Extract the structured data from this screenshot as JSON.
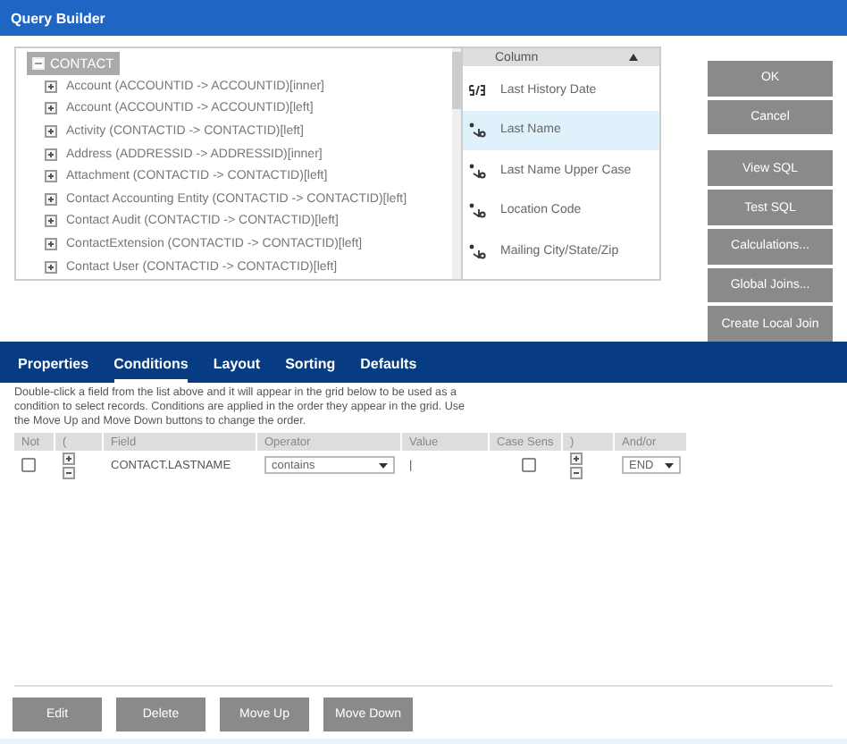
{
  "window": {
    "title": "Query Builder"
  },
  "tree": {
    "label": "CONTACT",
    "expanded": true,
    "children": [
      {
        "label": "Account (ACCOUNTID -> ACCOUNTID)[inner]",
        "expanded": false
      },
      {
        "label": "Account (ACCOUNTID -> ACCOUNTID)[left]",
        "expanded": false
      },
      {
        "label": "Activity (CONTACTID -> CONTACTID)[left]",
        "expanded": false
      },
      {
        "label": "Address (ADDRESSID -> ADDRESSID)[inner]",
        "expanded": false
      },
      {
        "label": "Attachment (CONTACTID -> CONTACTID)[left]",
        "expanded": false
      },
      {
        "label": "Contact Accounting Entity (CONTACTID -> CONTACTID)[left]",
        "expanded": false
      },
      {
        "label": "Contact Audit (CONTACTID -> CONTACTID)[left]",
        "expanded": false
      },
      {
        "label": "ContactExtension (CONTACTID -> CONTACTID)[left]",
        "expanded": false
      },
      {
        "label": "Contact User (CONTACTID -> CONTACTID)[left]",
        "expanded": false
      }
    ]
  },
  "columns": {
    "header": "Column",
    "items": [
      {
        "label": "Last History Date",
        "kind": "date",
        "selected": false
      },
      {
        "label": "Last Name",
        "kind": "text",
        "selected": true
      },
      {
        "label": "Last Name Upper Case",
        "kind": "text",
        "selected": false
      },
      {
        "label": "Location Code",
        "kind": "text",
        "selected": false
      },
      {
        "label": "Mailing City/State/Zip",
        "kind": "text",
        "selected": false
      }
    ]
  },
  "dialog_buttons": [
    "OK",
    "Cancel"
  ],
  "tool_buttons": [
    "View SQL",
    "Test SQL",
    "Calculations...",
    "Global Joins...",
    "Create Local Join"
  ],
  "tabs": [
    {
      "label": "Properties",
      "selected": false
    },
    {
      "label": "Conditions",
      "selected": true
    },
    {
      "label": "Layout",
      "selected": false
    },
    {
      "label": "Sorting",
      "selected": false
    },
    {
      "label": "Defaults",
      "selected": false
    }
  ],
  "help_text": "Double-click a field from the list above and it will appear in the grid below to be used as a condition to select records. Conditions are applied in the order they appear in the grid. Use the Move Up and Move Down buttons to change the order.",
  "grid": {
    "columns": [
      "Not",
      "(",
      "Field",
      "Operator",
      "Value",
      "Case Sens",
      ")",
      "And/or"
    ],
    "rows": [
      {
        "not": false,
        "field": "CONTACT.LASTNAME",
        "operator": "contains",
        "value": "|",
        "case_sens": false,
        "and_or": "END"
      }
    ]
  },
  "bottom_buttons": [
    "Edit",
    "Delete",
    "Move Up",
    "Move Down"
  ]
}
